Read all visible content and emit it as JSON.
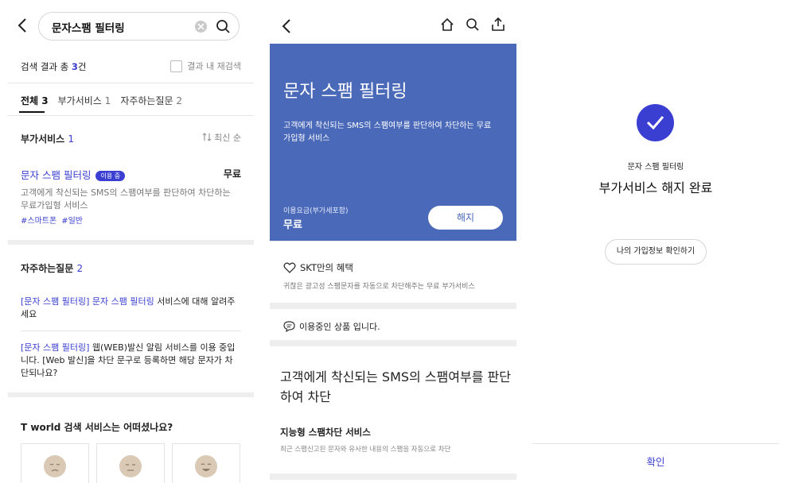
{
  "search_screen": {
    "search": {
      "query": "문자스팸 필터링"
    },
    "results": {
      "label_prefix": "검색 결과 총 ",
      "total": "3",
      "label_suffix": "건",
      "re_search_label": "결과 내 재검색"
    },
    "tabs": [
      {
        "label": "전체",
        "count": "3"
      },
      {
        "label": "부가서비스",
        "count": "1"
      },
      {
        "label": "자주하는질문",
        "count": "2"
      }
    ],
    "service_section": {
      "title": "부가서비스",
      "count": "1",
      "sort_label": "최신 순",
      "item": {
        "title": "문자 스팸 필터링",
        "badge": "이용 중",
        "price": "무료",
        "description": "고객에게 착신되는 SMS의 스팸여부를 판단하여 차단하는 무료가입형 서비스",
        "tags": [
          "#스마트폰",
          "#일반"
        ]
      }
    },
    "faq_section": {
      "title": "자주하는질문",
      "count": "2",
      "items": [
        {
          "highlight": "[문자 스팸 필터링] 문자 스팸 필터링",
          "text": " 서비스에 대해 알려주세요"
        },
        {
          "highlight": "[문자 스팸 필터링]",
          "text": " 웹(WEB)발신 알림 서비스를 이용 중입니다. [Web 발신]을 차단 문구로 등록하면 해당 문자가 차단되나요?"
        }
      ]
    },
    "survey": {
      "title": "T world 검색 서비스는 어떠셨나요?",
      "faces": [
        "sad-face-icon",
        "neutral-face-icon",
        "happy-face-icon"
      ]
    }
  },
  "detail_screen": {
    "hero": {
      "title": "문자 스팸 필터링",
      "description": "고객에게 착신되는 SMS의 스팸여부를 판단하여 차단하는 무료가입형 서비스",
      "fee_label": "이용요금(부가세포함)",
      "fee_value": "무료",
      "cancel_label": "해지",
      "color": "#4a69b8"
    },
    "benefit": {
      "title": "SKT만의 혜택",
      "description": "귀찮은 광고성 스팸문자를 자동으로 차단해주는 무료 부가서비스"
    },
    "in_use": "이용중인 상품 입니다.",
    "headline": "고객에게 착신되는 SMS의 스팸여부를 판단하여 차단",
    "feature": {
      "title": "지능형 스팸차단 서비스",
      "description": "최근 스팸신고된 문자와 유사한 내용의 스팸을 자동으로 차단"
    }
  },
  "complete_screen": {
    "service_name": "문자 스팸 필터링",
    "title": "부가서비스 해지 완료",
    "my_info_button": "나의 가입정보 확인하기",
    "confirm_button": "확인"
  },
  "colors": {
    "accent": "#3a3fd1",
    "hero_blue": "#4a69b8",
    "band_gray": "#eeeeee"
  }
}
